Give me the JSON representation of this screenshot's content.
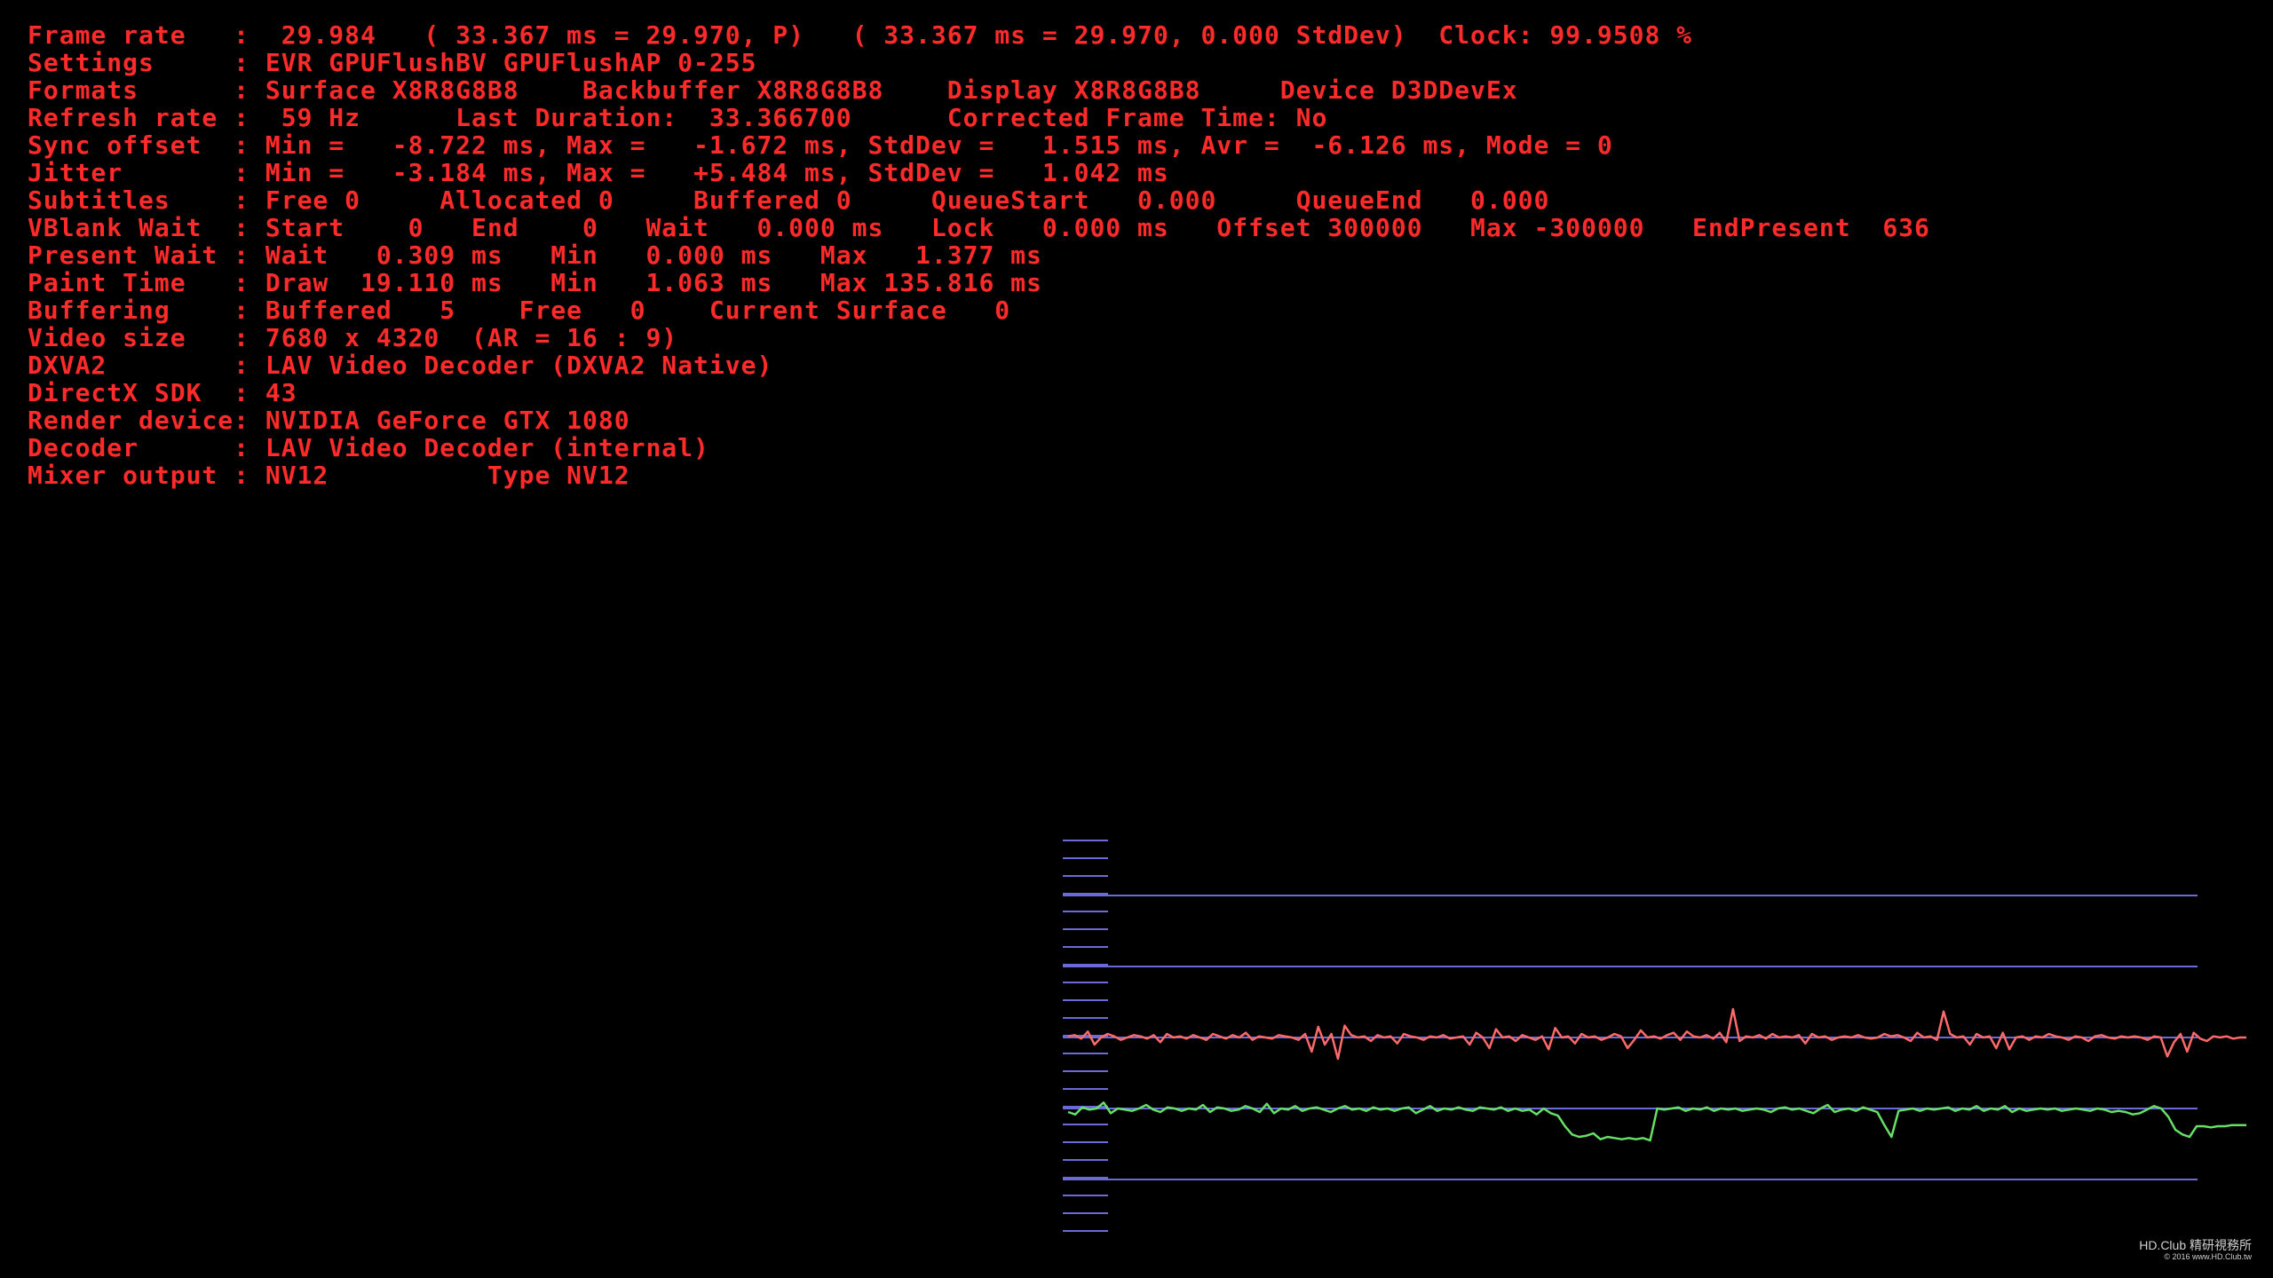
{
  "stats": [
    "Frame rate   :  29.984   ( 33.367 ms = 29.970, P)   ( 33.367 ms = 29.970, 0.000 StdDev)  Clock: 99.9508 %",
    "Settings     : EVR GPUFlushBV GPUFlushAP 0-255",
    "Formats      : Surface X8R8G8B8    Backbuffer X8R8G8B8    Display X8R8G8B8     Device D3DDevEx",
    "Refresh rate :  59 Hz      Last Duration:  33.366700      Corrected Frame Time: No",
    "Sync offset  : Min =   -8.722 ms, Max =   -1.672 ms, StdDev =   1.515 ms, Avr =  -6.126 ms, Mode = 0",
    "Jitter       : Min =   -3.184 ms, Max =   +5.484 ms, StdDev =   1.042 ms",
    "Subtitles    : Free 0     Allocated 0     Buffered 0     QueueStart   0.000     QueueEnd   0.000",
    "VBlank Wait  : Start    0   End    0   Wait   0.000 ms   Lock   0.000 ms   Offset 300000   Max -300000   EndPresent  636",
    "Present Wait : Wait   0.309 ms   Min   0.000 ms   Max   1.377 ms",
    "Paint Time   : Draw  19.110 ms   Min   1.063 ms   Max 135.816 ms",
    "Buffering    : Buffered   5    Free   0    Current Surface   0",
    "Video size   : 7680 x 4320  (AR = 16 : 9)",
    "DXVA2        : LAV Video Decoder (DXVA2 Native)",
    "DirectX SDK  : 43",
    "Render device: NVIDIA GeForce GTX 1080",
    "Decoder      : LAV Video Decoder (internal)",
    "Mixer output : NV12          Type NV12"
  ],
  "colors": {
    "background": "#000000",
    "stats_text": "#ff2a2a",
    "grid": "#6a6ad8",
    "sync_line": "#66e066",
    "jitter_line": "#ff6a6a"
  },
  "chart_data": {
    "type": "line",
    "x": [
      0,
      1,
      2,
      3,
      4,
      5,
      6,
      7,
      8,
      9,
      10,
      11,
      12,
      13,
      14,
      15,
      16,
      17,
      18,
      19,
      20,
      21,
      22,
      23,
      24,
      25,
      26,
      27,
      28,
      29,
      30,
      31,
      32,
      33,
      34,
      35,
      36,
      37,
      38,
      39,
      40,
      41,
      42,
      43,
      44,
      45,
      46,
      47,
      48,
      49,
      50,
      51,
      52,
      53,
      54,
      55,
      56,
      57,
      58,
      59,
      60,
      61,
      62,
      63,
      64,
      65,
      66,
      67,
      68,
      69,
      70,
      71,
      72,
      73,
      74,
      75,
      76,
      77,
      78,
      79,
      80,
      81,
      82,
      83,
      84,
      85,
      86,
      87,
      88,
      89,
      90,
      91,
      92,
      93,
      94,
      95,
      96,
      97,
      98,
      99,
      100,
      101,
      102,
      103,
      104,
      105,
      106,
      107,
      108,
      109,
      110,
      111,
      112,
      113,
      114,
      115,
      116,
      117,
      118,
      119,
      120,
      121,
      122,
      123,
      124,
      125,
      126,
      127,
      128,
      129,
      130,
      131,
      132,
      133,
      134,
      135,
      136,
      137,
      138,
      139,
      140,
      141,
      142,
      143,
      144,
      145,
      146,
      147,
      148,
      149,
      150,
      151,
      152,
      153,
      154,
      155,
      156,
      157,
      158,
      159,
      160,
      161,
      162,
      163,
      164
    ],
    "series": [
      {
        "values": [
          -6.3,
          -6.5,
          -5.9,
          -6.1,
          -6.0,
          -5.5,
          -6.4,
          -6.0,
          -6.1,
          -6.2,
          -6.0,
          -5.7,
          -6.1,
          -6.3,
          -5.9,
          -6.0,
          -6.2,
          -6.0,
          -6.1,
          -5.7,
          -6.3,
          -5.9,
          -6.0,
          -6.2,
          -6.1,
          -5.8,
          -6.0,
          -6.3,
          -5.6,
          -6.4,
          -6.0,
          -6.1,
          -5.8,
          -6.2,
          -6.0,
          -5.9,
          -6.1,
          -6.3,
          -6.0,
          -5.8,
          -6.1,
          -6.0,
          -6.2,
          -5.9,
          -6.1,
          -6.0,
          -6.2,
          -6.0,
          -5.9,
          -6.4,
          -6.1,
          -5.8,
          -6.2,
          -6.0,
          -6.1,
          -5.9,
          -6.1,
          -6.2,
          -5.9,
          -6.0,
          -6.1,
          -5.9,
          -6.2,
          -6.0,
          -6.2,
          -6.1,
          -6.5,
          -6.0,
          -6.4,
          -6.6,
          -7.5,
          -8.2,
          -8.4,
          -8.3,
          -8.1,
          -8.6,
          -8.4,
          -8.5,
          -8.6,
          -8.5,
          -8.6,
          -8.5,
          -8.7,
          -6.0,
          -6.1,
          -6.0,
          -5.9,
          -6.2,
          -6.0,
          -6.1,
          -5.9,
          -6.2,
          -6.0,
          -6.1,
          -6.0,
          -6.2,
          -6.1,
          -6.0,
          -6.1,
          -6.3,
          -6.0,
          -5.9,
          -6.1,
          -6.0,
          -6.2,
          -6.4,
          -6.0,
          -5.7,
          -6.3,
          -6.1,
          -6.0,
          -6.2,
          -5.9,
          -6.1,
          -6.3,
          -7.4,
          -8.4,
          -6.2,
          -6.1,
          -6.0,
          -6.2,
          -6.0,
          -6.1,
          -6.0,
          -5.9,
          -6.2,
          -6.0,
          -6.1,
          -5.8,
          -6.2,
          -6.0,
          -6.1,
          -5.8,
          -6.3,
          -6.0,
          -6.2,
          -6.1,
          -6.0,
          -6.1,
          -6.0,
          -6.2,
          -6.1,
          -6.0,
          -6.1,
          -6.2,
          -6.0,
          -6.1,
          -6.3,
          -6.2,
          -6.3,
          -6.5,
          -6.4,
          -6.1,
          -5.8,
          -6.0,
          -6.7,
          -7.8,
          -8.2,
          -8.4,
          -7.5,
          -7.5,
          -7.6,
          -7.5,
          -7.5,
          -7.4,
          -7.4,
          -7.4
        ]
      },
      {
        "values": [
          0.1,
          0.2,
          -0.1,
          0.5,
          -0.6,
          0.0,
          0.3,
          0.1,
          -0.2,
          0.0,
          0.2,
          0.1,
          -0.1,
          0.2,
          -0.4,
          0.3,
          0.0,
          0.1,
          -0.1,
          0.2,
          0.0,
          -0.2,
          0.3,
          0.1,
          -0.1,
          0.2,
          0.0,
          0.4,
          -0.2,
          0.1,
          0.0,
          -0.1,
          0.2,
          0.1,
          0.0,
          -0.2,
          0.3,
          -1.2,
          0.9,
          -0.6,
          0.3,
          -1.8,
          1.0,
          0.2,
          0.0,
          0.1,
          -0.3,
          0.2,
          0.0,
          0.1,
          -0.5,
          0.3,
          0.1,
          0.0,
          -0.2,
          0.1,
          0.0,
          0.2,
          -0.1,
          0.0,
          0.1,
          -0.6,
          0.4,
          0.0,
          -0.9,
          0.7,
          0.0,
          0.1,
          -0.3,
          0.2,
          0.0,
          -0.2,
          0.1,
          -1.0,
          0.8,
          0.0,
          0.1,
          -0.5,
          0.3,
          0.0,
          0.1,
          -0.2,
          0.0,
          0.3,
          0.1,
          -0.9,
          -0.2,
          0.6,
          0.0,
          0.1,
          -0.1,
          0.2,
          0.4,
          -0.2,
          0.5,
          0.1,
          0.0,
          0.2,
          -0.1,
          0.4,
          -0.4,
          2.4,
          -0.3,
          0.1,
          0.0,
          0.2,
          -0.1,
          0.3,
          0.0,
          0.1,
          0.0,
          0.2,
          -0.5,
          0.3,
          0.0,
          0.1,
          -0.2,
          0.0,
          0.1,
          0.0,
          0.2,
          0.0,
          -0.1,
          0.0,
          0.3,
          0.1,
          0.2,
          0.0,
          -0.3,
          0.4,
          0.0,
          0.1,
          -0.2,
          2.2,
          0.3,
          0.0,
          0.1,
          -0.6,
          0.3,
          0.0,
          0.1,
          -0.9,
          0.4,
          -1.0,
          0.0,
          0.1,
          -0.2,
          0.1,
          0.0,
          0.3,
          0.1,
          0.0,
          -0.2,
          0.1,
          0.0,
          -0.3,
          0.1,
          0.2,
          0.0,
          -0.1,
          0.1,
          0.0,
          0.1,
          0.0,
          -0.2,
          0.1,
          0.0,
          -1.6,
          -0.4,
          0.3,
          -1.2,
          0.4,
          -0.1,
          -0.3,
          0.1,
          0.0,
          0.1,
          -0.1,
          0.0,
          0.0
        ]
      }
    ],
    "ylim": [
      -12,
      12
    ],
    "grid": true
  }
}
